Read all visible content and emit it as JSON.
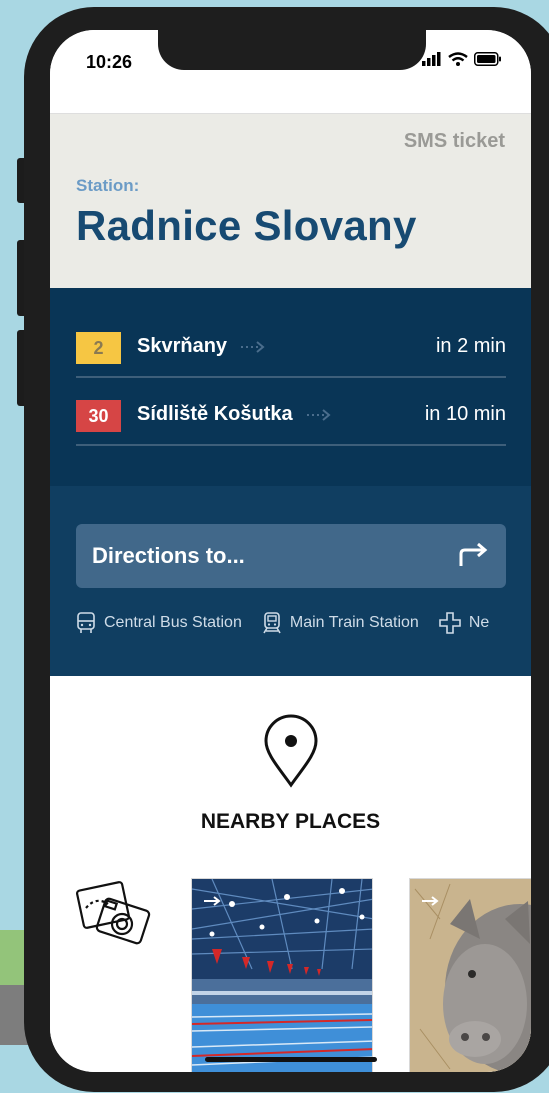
{
  "status_bar": {
    "time": "10:26"
  },
  "header": {
    "sms_ticket": "SMS ticket",
    "station_label": "Station:",
    "station_name": "Radnice Slovany"
  },
  "departures": [
    {
      "line": "2",
      "destination": "Skvrňany",
      "eta": "in 2 min",
      "badge_bg": "#f6c643",
      "badge_fg": "#8a7a52"
    },
    {
      "line": "30",
      "destination": "Sídliště Košutka",
      "eta": "in 10 min",
      "badge_bg": "#d64545",
      "badge_fg": "#ffffff"
    }
  ],
  "directions": {
    "label": "Directions to...",
    "quick": [
      {
        "icon": "bus-icon",
        "label": "Central Bus Station"
      },
      {
        "icon": "train-icon",
        "label": "Main Train Station"
      },
      {
        "icon": "hospital-cross-icon",
        "label": "Ne"
      }
    ]
  },
  "nearby": {
    "title": "NEARBY PLACES",
    "cards": [
      {
        "icon": "camera-icon"
      },
      {
        "name": "swimming-pool-photo"
      },
      {
        "name": "rhino-photo"
      }
    ]
  },
  "colors": {
    "header_bg": "#ebebe6",
    "station_name": "#174a72",
    "departures_bg": "#093556",
    "directions_bg": "#103e61",
    "button_bg": "#41688a"
  }
}
